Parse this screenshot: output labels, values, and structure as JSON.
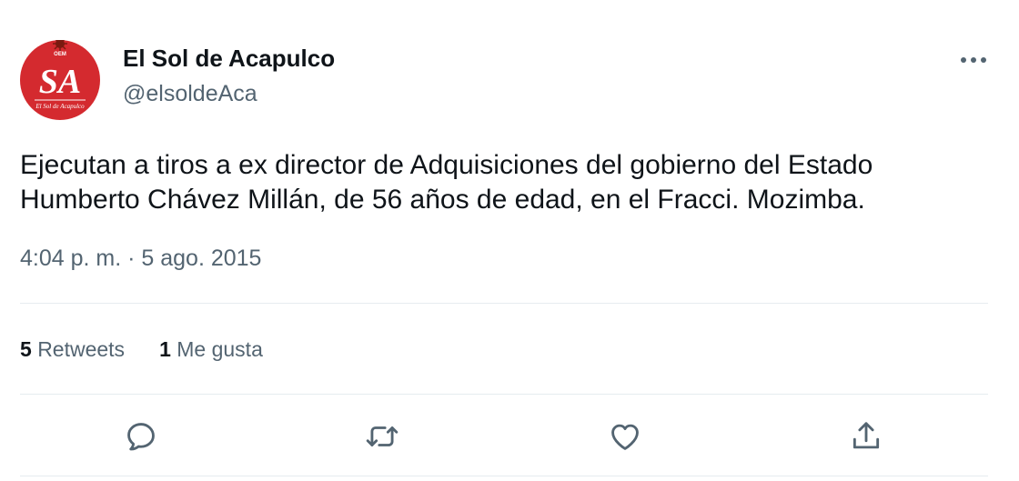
{
  "author": {
    "display_name": "El Sol de Acapulco",
    "handle": "@elsoldeAca",
    "avatar": {
      "monogram": "SA",
      "caption": "El Sol de Acapulco",
      "badge": "OEM",
      "background_color": "#d42a2f"
    }
  },
  "menu_icon": "more-icon",
  "tweet": {
    "text_line1": "Ejecutan a tiros a ex director de Adquisiciones del gobierno del Estado",
    "text_line2": "Humberto Chávez Millán, de 56 años de edad, en el Fracci. Mozimba.",
    "time": "4:04 p. m.",
    "separator": " · ",
    "date": "5 ago. 2015"
  },
  "stats": {
    "retweets_count": "5",
    "retweets_label": "Retweets",
    "likes_count": "1",
    "likes_label": "Me gusta"
  },
  "actions": [
    {
      "icon": "reply-icon"
    },
    {
      "icon": "retweet-icon"
    },
    {
      "icon": "like-icon"
    },
    {
      "icon": "share-icon"
    }
  ],
  "colors": {
    "text_primary": "#0f1419",
    "text_secondary": "#536471",
    "divider": "#e6ecf0",
    "brand_red": "#d42a2f"
  }
}
